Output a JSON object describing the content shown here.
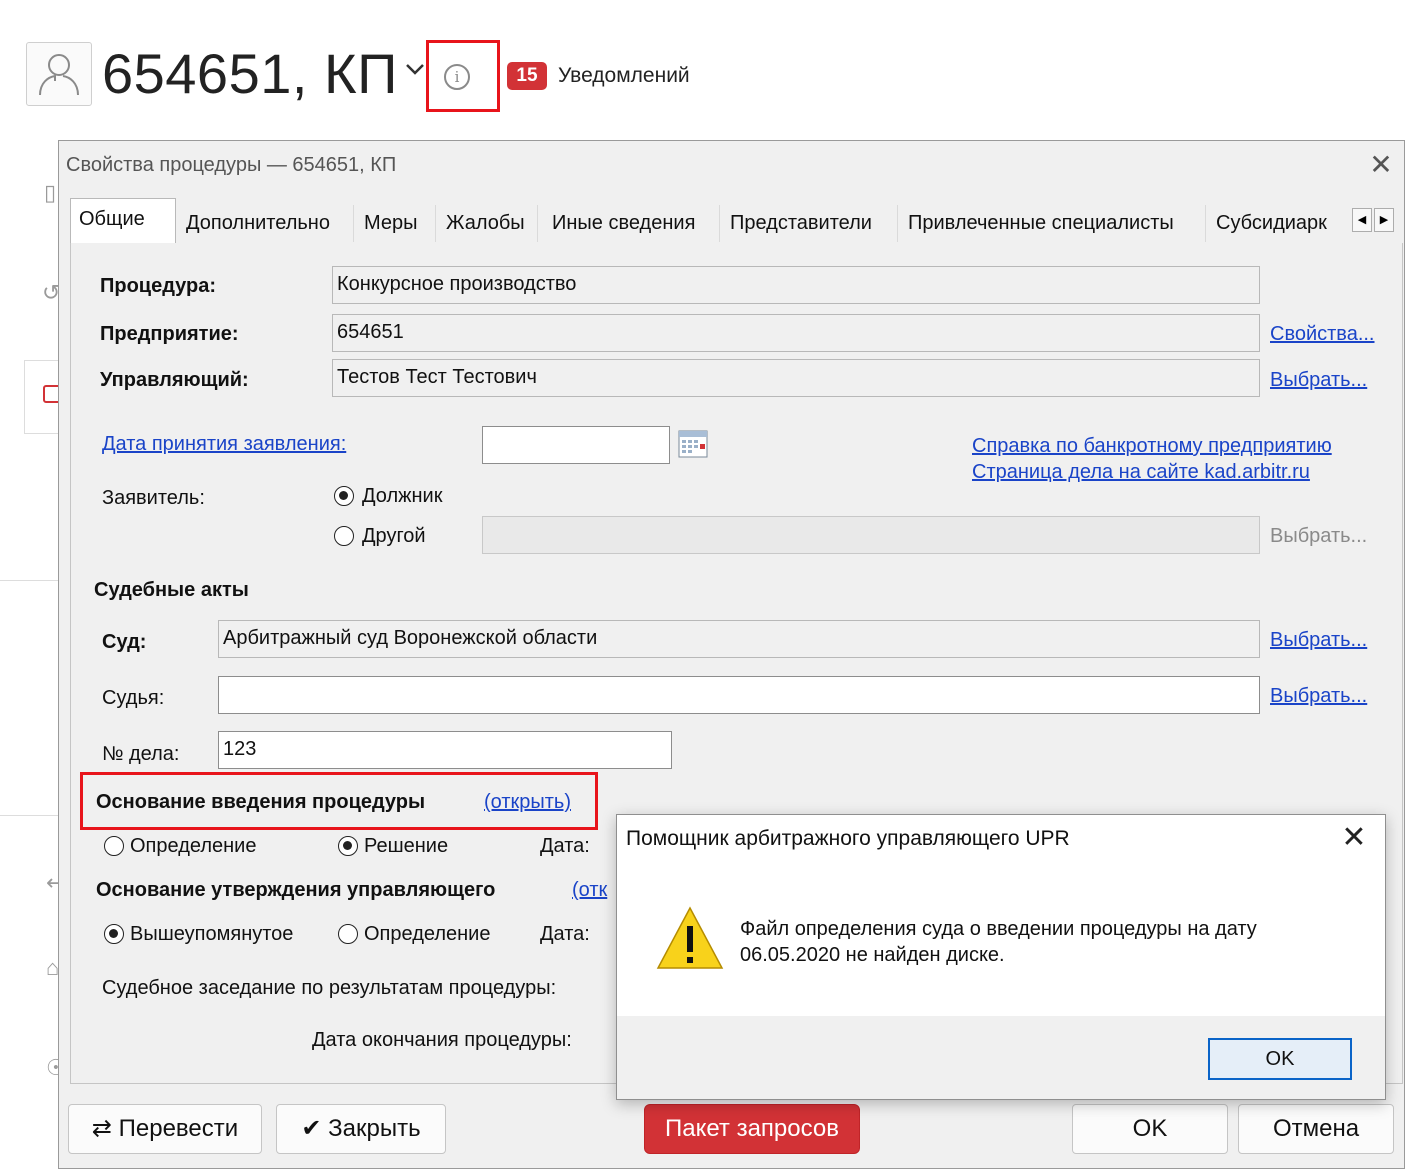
{
  "header": {
    "title": "654651, КП",
    "notifications_count": "15",
    "notifications_label": "Уведомлений"
  },
  "dialog": {
    "title": "Свойства процедуры — 654651, КП",
    "tabs": [
      {
        "label": "Общие",
        "active": true
      },
      {
        "label": "Дополнительно"
      },
      {
        "label": "Меры"
      },
      {
        "label": "Жалобы"
      },
      {
        "label": "Иные сведения"
      },
      {
        "label": "Представители"
      },
      {
        "label": "Привлеченные специалисты"
      },
      {
        "label": "Субсидиарк"
      }
    ],
    "general": {
      "procedure_label": "Процедура:",
      "procedure_value": "Конкурсное производство",
      "enterprise_label": "Предприятие:",
      "enterprise_value": "654651",
      "enterprise_link": "Свойства...",
      "manager_label": "Управляющий:",
      "manager_value": "Тестов Тест Тестович",
      "manager_link": "Выбрать...",
      "application_date_link": "Дата принятия заявления:",
      "application_date_value": "",
      "bankrupt_info_link": "Справка по банкротному предприятию",
      "kad_link": "Страница дела на сайте kad.arbitr.ru",
      "applicant_label": "Заявитель:",
      "applicant_options": [
        {
          "label": "Должник",
          "selected": true
        },
        {
          "label": "Другой",
          "selected": false
        }
      ],
      "applicant_other_value": "",
      "applicant_select_link": "Выбрать..."
    },
    "court_acts": {
      "section_title": "Судебные акты",
      "court_label": "Суд:",
      "court_value": "Арбитражный суд Воронежской области",
      "court_link": "Выбрать...",
      "judge_label": "Судья:",
      "judge_value": "",
      "judge_link": "Выбрать...",
      "case_no_label": "№ дела:",
      "case_no_value": "123"
    },
    "basis_intro": {
      "title": "Основание введения процедуры",
      "open_link": "(открыть)",
      "options": [
        {
          "label": "Определение",
          "selected": false
        },
        {
          "label": "Решение",
          "selected": true
        }
      ],
      "date_label": "Дата:"
    },
    "basis_approval": {
      "title": "Основание утверждения управляющего",
      "open_link_partial": "(отк",
      "options": [
        {
          "label": "Вышеупомянутое",
          "selected": true
        },
        {
          "label": "Определение",
          "selected": false
        }
      ],
      "date_label": "Дата:"
    },
    "court_session_label": "Судебное заседание по результатам процедуры:",
    "end_date_label": "Дата окончания процедуры:",
    "buttons": {
      "transfer": "Перевести",
      "close": "Закрыть",
      "batch": "Пакет запросов",
      "ok": "OK",
      "cancel": "Отмена"
    }
  },
  "message_box": {
    "title": "Помощник арбитражного управляющего UPR",
    "message": "Файл определения суда о введении процедуры на дату 06.05.2020 не найден диске.",
    "ok_label": "OK",
    "icon": "warning-icon"
  },
  "colors": {
    "highlight_red": "#e8141b",
    "badge_red": "#d23236",
    "link_blue": "#1a44c8",
    "focus_blue": "#0a64c8"
  }
}
